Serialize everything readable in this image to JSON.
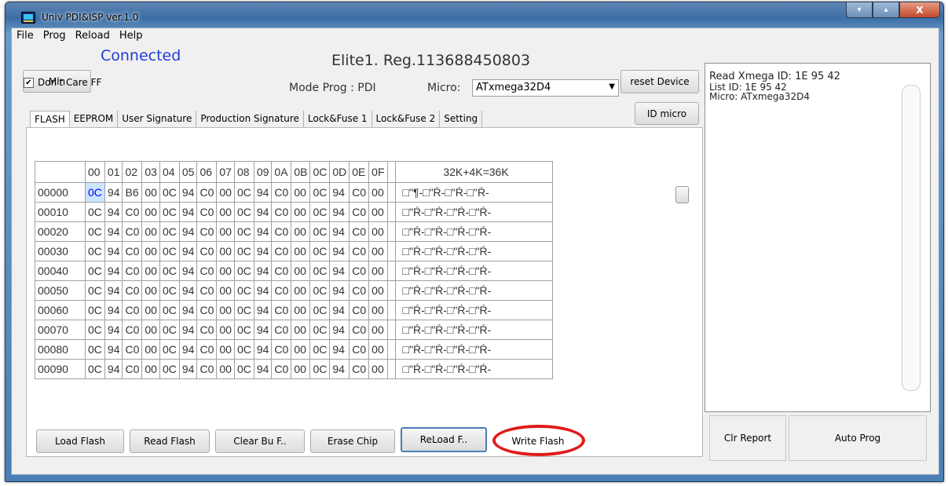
{
  "window": {
    "title": "Univ PDI&ISP  ver.1.0"
  },
  "window_controls": {
    "minimize": "▾",
    "maximize": "▴",
    "close": "X"
  },
  "menu": [
    "File",
    "Prog",
    "Reload",
    "Help"
  ],
  "top": {
    "min_button": "Min",
    "status": "Connected",
    "device_info": "Elite1.   Reg.113688450803",
    "reset_button": "reset Device",
    "dont_care_label": "Don't Care FF",
    "dont_care_checked": "✔",
    "mode_prog": "Mode Prog : PDI",
    "micro_label": "Micro:",
    "micro_value": "ATxmega32D4",
    "id_micro_button": "ID micro"
  },
  "tabs": [
    "FLASH",
    "EEPROM",
    "User Signature",
    "Production Signature",
    "Lock&Fuse 1",
    "Lock&Fuse 2",
    "Setting"
  ],
  "grid": {
    "columns": [
      "00",
      "01",
      "02",
      "03",
      "04",
      "05",
      "06",
      "07",
      "08",
      "09",
      "0A",
      "0B",
      "0C",
      "0D",
      "0E",
      "0F"
    ],
    "ascii_header": "32K+4K=36K",
    "rows": [
      {
        "addr": "00000",
        "bytes": [
          "0C",
          "94",
          "B6",
          "00",
          "0C",
          "94",
          "C0",
          "00",
          "0C",
          "94",
          "C0",
          "00",
          "0C",
          "94",
          "C0",
          "00"
        ],
        "ascii": "□\"¶-□\"Ŕ-□\"Ŕ-□\"Ŕ-"
      },
      {
        "addr": "00010",
        "bytes": [
          "0C",
          "94",
          "C0",
          "00",
          "0C",
          "94",
          "C0",
          "00",
          "0C",
          "94",
          "C0",
          "00",
          "0C",
          "94",
          "C0",
          "00"
        ],
        "ascii": "□\"Ŕ-□\"Ŕ-□\"Ŕ-□\"Ŕ-"
      },
      {
        "addr": "00020",
        "bytes": [
          "0C",
          "94",
          "C0",
          "00",
          "0C",
          "94",
          "C0",
          "00",
          "0C",
          "94",
          "C0",
          "00",
          "0C",
          "94",
          "C0",
          "00"
        ],
        "ascii": "□\"Ŕ-□\"Ŕ-□\"Ŕ-□\"Ŕ-"
      },
      {
        "addr": "00030",
        "bytes": [
          "0C",
          "94",
          "C0",
          "00",
          "0C",
          "94",
          "C0",
          "00",
          "0C",
          "94",
          "C0",
          "00",
          "0C",
          "94",
          "C0",
          "00"
        ],
        "ascii": "□\"Ŕ-□\"Ŕ-□\"Ŕ-□\"Ŕ-"
      },
      {
        "addr": "00040",
        "bytes": [
          "0C",
          "94",
          "C0",
          "00",
          "0C",
          "94",
          "C0",
          "00",
          "0C",
          "94",
          "C0",
          "00",
          "0C",
          "94",
          "C0",
          "00"
        ],
        "ascii": "□\"Ŕ-□\"Ŕ-□\"Ŕ-□\"Ŕ-"
      },
      {
        "addr": "00050",
        "bytes": [
          "0C",
          "94",
          "C0",
          "00",
          "0C",
          "94",
          "C0",
          "00",
          "0C",
          "94",
          "C0",
          "00",
          "0C",
          "94",
          "C0",
          "00"
        ],
        "ascii": "□\"Ŕ-□\"Ŕ-□\"Ŕ-□\"Ŕ-"
      },
      {
        "addr": "00060",
        "bytes": [
          "0C",
          "94",
          "C0",
          "00",
          "0C",
          "94",
          "C0",
          "00",
          "0C",
          "94",
          "C0",
          "00",
          "0C",
          "94",
          "C0",
          "00"
        ],
        "ascii": "□\"Ŕ-□\"Ŕ-□\"Ŕ-□\"Ŕ-"
      },
      {
        "addr": "00070",
        "bytes": [
          "0C",
          "94",
          "C0",
          "00",
          "0C",
          "94",
          "C0",
          "00",
          "0C",
          "94",
          "C0",
          "00",
          "0C",
          "94",
          "C0",
          "00"
        ],
        "ascii": "□\"Ŕ-□\"Ŕ-□\"Ŕ-□\"Ŕ-"
      },
      {
        "addr": "00080",
        "bytes": [
          "0C",
          "94",
          "C0",
          "00",
          "0C",
          "94",
          "C0",
          "00",
          "0C",
          "94",
          "C0",
          "00",
          "0C",
          "94",
          "C0",
          "00"
        ],
        "ascii": "□\"Ŕ-□\"Ŕ-□\"Ŕ-□\"Ŕ-"
      },
      {
        "addr": "00090",
        "bytes": [
          "0C",
          "94",
          "C0",
          "00",
          "0C",
          "94",
          "C0",
          "00",
          "0C",
          "94",
          "C0",
          "00",
          "0C",
          "94",
          "C0",
          "00"
        ],
        "ascii": "□\"Ŕ-□\"Ŕ-□\"Ŕ-□\"Ŕ-"
      }
    ]
  },
  "bottom_buttons": {
    "load_flash": "Load Flash",
    "read_flash": "Read Flash",
    "clear_buffer": "Clear Bu F..",
    "erase_chip": "Erase Chip",
    "reload_flash": "ReLoad F..",
    "write_flash": "Write Flash"
  },
  "report": {
    "lines": [
      "Read Xmega ID: 1E 95 42",
      "List ID: 1E 95 42",
      "Micro: ATxmega32D4"
    ]
  },
  "report_buttons": {
    "clr_report": "Clr Report",
    "auto_prog": "Auto Prog"
  },
  "colors": {
    "connected": "#1e3ad8",
    "highlight_oval": "#e01b1b",
    "selected_cell": "#cce4ff"
  }
}
